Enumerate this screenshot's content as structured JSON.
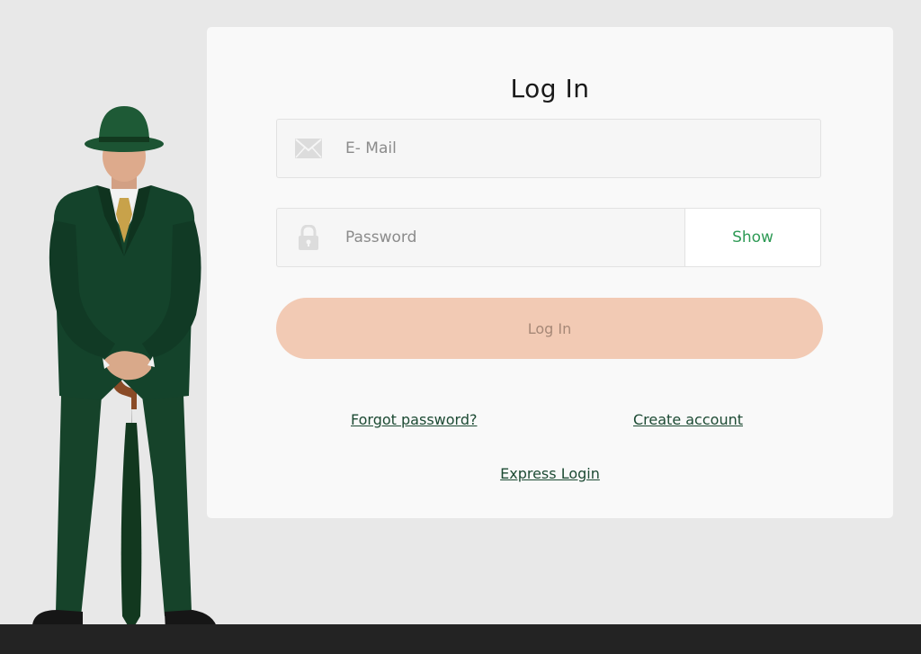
{
  "login": {
    "title": "Log In",
    "email_placeholder": "E- Mail",
    "password_placeholder": "Password",
    "show_label": "Show",
    "submit_label": "Log In",
    "forgot_label": "Forgot password?",
    "create_label": "Create account",
    "express_label": "Express Login"
  },
  "icons": {
    "email": "envelope-icon",
    "password": "lock-icon"
  },
  "colors": {
    "page_bg": "#e8e8e8",
    "card_bg": "#f9f9f9",
    "accent_green": "#2e9a55",
    "link_green": "#1c4a33",
    "submit_bg": "#f2cab4",
    "footer_bg": "#232323",
    "suit_green": "#14432b"
  }
}
